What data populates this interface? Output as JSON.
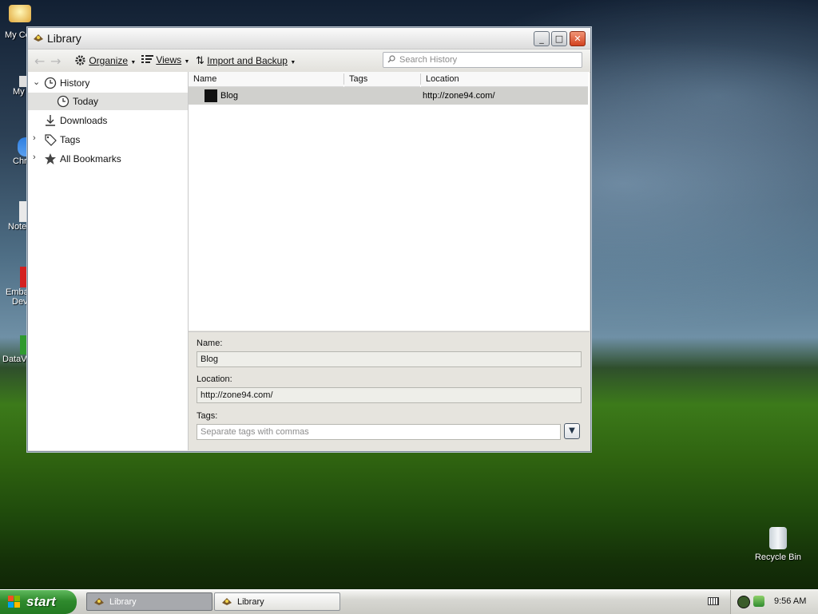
{
  "desktop": {
    "icons_partial": [
      "My Co",
      "My",
      "Chr",
      "Note",
      "Emba",
      "Dev",
      "DataV"
    ],
    "recycle_bin_label": "Recycle Bin"
  },
  "window": {
    "title": "Library",
    "buttons": {
      "minimize": "_",
      "maximize": "□",
      "close": "✕"
    }
  },
  "toolbar": {
    "organize": "Organize",
    "views": "Views",
    "import_backup": "Import and Backup",
    "search_placeholder": "Search History"
  },
  "sidebar": {
    "items": [
      {
        "label": "History",
        "expanded": true
      },
      {
        "label": "Today",
        "selected": true
      },
      {
        "label": "Downloads"
      },
      {
        "label": "Tags",
        "expanded": false
      },
      {
        "label": "All Bookmarks",
        "expanded": false
      }
    ]
  },
  "table": {
    "columns": [
      "Name",
      "Tags",
      "Location"
    ],
    "rows": [
      {
        "name": "Blog",
        "tags": "",
        "location": "http://zone94.com/"
      }
    ]
  },
  "details": {
    "name_label": "Name:",
    "name_value": "Blog",
    "location_label": "Location:",
    "location_value": "http://zone94.com/",
    "tags_label": "Tags:",
    "tags_placeholder": "Separate tags with commas"
  },
  "taskbar": {
    "start_label": "start",
    "tasks": [
      {
        "label": "Library",
        "active": true
      },
      {
        "label": "Library",
        "active": false
      }
    ],
    "clock": "9:56 AM"
  }
}
